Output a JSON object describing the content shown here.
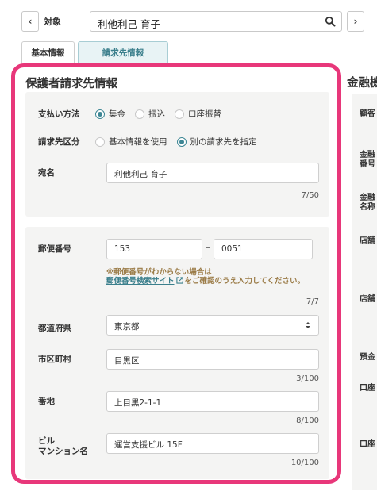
{
  "search": {
    "prev_label": "‹",
    "next_label": "›",
    "label": "対象",
    "value": "利他利己 育子",
    "icon": "search-icon"
  },
  "tabs": [
    {
      "label": "基本情報",
      "active": false
    },
    {
      "label": "請求先情報",
      "active": true
    }
  ],
  "section": {
    "title": "保護者請求先情報",
    "payment_method": {
      "label": "支払い方法",
      "options": [
        "集金",
        "振込",
        "口座振替"
      ],
      "selected": "集金"
    },
    "billing_type": {
      "label": "請求先区分",
      "options": [
        "基本情報を使用",
        "別の請求先を指定"
      ],
      "selected": "別の請求先を指定"
    },
    "addressee": {
      "label": "宛名",
      "value": "利他利己 育子",
      "counter": "7/50"
    },
    "postal": {
      "label": "郵便番号",
      "part1": "153",
      "separator": "–",
      "part2": "0051",
      "note_prefix": "※郵便番号がわからない場合は",
      "note_link": "郵便番号検索サイト",
      "note_suffix": "をご確認のうえ入力してください。",
      "counter": "7/7"
    },
    "prefecture": {
      "label": "都道府県",
      "value": "東京都"
    },
    "city": {
      "label": "市区町村",
      "value": "目黒区",
      "counter": "3/100"
    },
    "street": {
      "label": "番地",
      "value": "上目黒2-1-1",
      "counter": "8/100"
    },
    "building": {
      "label_line1": "ビル",
      "label_line2": "マンション名",
      "value": "運営支援ビル 15F",
      "counter": "10/100"
    }
  },
  "right_section": {
    "title": "金融機",
    "labels": [
      "顧客",
      "金融",
      "番号",
      "金融",
      "名称",
      "店舗",
      "店舗",
      "預金",
      "口座",
      "口座"
    ]
  },
  "colors": {
    "highlight": "#e8377a",
    "accent": "#3d8694",
    "note": "#9a7a45"
  }
}
